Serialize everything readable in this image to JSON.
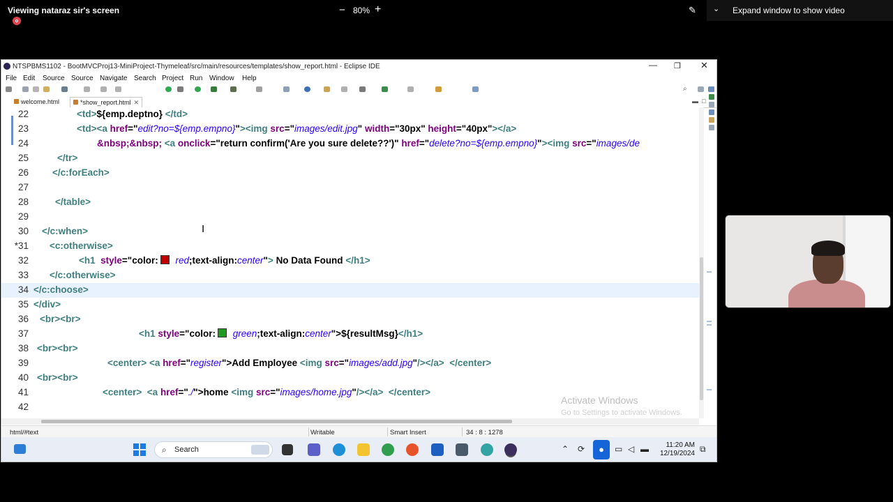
{
  "meeting": {
    "title": "Viewing nataraz sir's screen",
    "zoom_minus": "−",
    "zoom": "80%",
    "zoom_plus": "+",
    "expand_label": "Expand window to show video",
    "chevron": "⌄"
  },
  "eclipse": {
    "window_title": "NTSPBMS1102 - BootMVCProj13-MiniProject-Thymeleaf/src/main/resources/templates/show_report.html - Eclipse IDE",
    "menu": [
      "File",
      "Edit",
      "Source",
      "Source",
      "Navigate",
      "Search",
      "Project",
      "Run",
      "Window",
      "Help"
    ],
    "tabs": [
      {
        "label": "welcome.html"
      },
      {
        "label": "*show_report.html",
        "close": "✕"
      }
    ],
    "status": {
      "path": "html/#text",
      "mode": "Writable",
      "insert": "Smart Insert",
      "position": "34 : 8 : 1278"
    },
    "watermark_title": "Activate Windows",
    "watermark_sub": "Go to Settings to activate Windows."
  },
  "code_lines": [
    {
      "n": "22",
      "parts": [
        [
          "tag",
          "<td>"
        ],
        [
          "text",
          "${emp.deptno} "
        ],
        [
          "tag",
          "</td>"
        ]
      ]
    },
    {
      "n": "23",
      "parts": [
        [
          "tag",
          "<td><a "
        ],
        [
          "attr",
          "href"
        ],
        [
          "sym",
          "="
        ],
        [
          "sym",
          "\""
        ],
        [
          "str",
          "edit?no=${emp.empno}"
        ],
        [
          "sym",
          "\""
        ],
        [
          "tag",
          "><img "
        ],
        [
          "attr",
          "src"
        ],
        [
          "sym",
          "="
        ],
        [
          "sym",
          "\""
        ],
        [
          "str",
          "images/edit.jpg"
        ],
        [
          "sym",
          "\" "
        ],
        [
          "attr",
          "width"
        ],
        [
          "sym",
          "=\"30px\" "
        ],
        [
          "attr",
          "height"
        ],
        [
          "sym",
          "=\"40px\""
        ],
        [
          "tag",
          "></a>"
        ]
      ]
    },
    {
      "n": "24",
      "parts": [
        [
          "attr",
          "&nbsp;&nbsp; "
        ],
        [
          "tag",
          "<a "
        ],
        [
          "attr",
          "onclick"
        ],
        [
          "sym",
          "=\"return confirm('Are you sure delete??')\" "
        ],
        [
          "attr",
          "href"
        ],
        [
          "sym",
          "=\""
        ],
        [
          "str",
          "delete?no=${emp.empno}"
        ],
        [
          "sym",
          "\""
        ],
        [
          "tag",
          "><img "
        ],
        [
          "attr",
          "src"
        ],
        [
          "sym",
          "=\""
        ],
        [
          "str",
          "images/de"
        ]
      ]
    },
    {
      "n": "25",
      "parts": [
        [
          "tag",
          "</tr>"
        ]
      ]
    },
    {
      "n": "26",
      "parts": [
        [
          "tag",
          "</c:forEach>"
        ]
      ]
    },
    {
      "n": "27",
      "parts": []
    },
    {
      "n": "28",
      "parts": [
        [
          "tag",
          "</table>"
        ]
      ]
    },
    {
      "n": "29",
      "parts": []
    },
    {
      "n": "30",
      "parts": [
        [
          "tag",
          "</c:when>"
        ]
      ]
    },
    {
      "n": "31",
      "parts": [
        [
          "tag",
          "<c:otherwise>"
        ]
      ]
    },
    {
      "n": "32",
      "parts": [
        [
          "tag",
          "<h1  "
        ],
        [
          "attr",
          "style"
        ],
        [
          "sym",
          "=\"color:"
        ],
        [
          "swatch",
          "red"
        ],
        [
          "str",
          " red"
        ],
        [
          "sym",
          ";text-align:"
        ],
        [
          "str",
          "center"
        ],
        [
          "sym",
          "\""
        ],
        [
          "tag",
          "> "
        ],
        [
          "text",
          "No Data Found "
        ],
        [
          "tag",
          "</h1>"
        ]
      ]
    },
    {
      "n": "33",
      "parts": [
        [
          "tag",
          "</c:otherwise>"
        ]
      ]
    },
    {
      "n": "34",
      "parts": [
        [
          "tag",
          "</c:choose>"
        ]
      ]
    },
    {
      "n": "35",
      "parts": [
        [
          "tag",
          "</div>"
        ]
      ]
    },
    {
      "n": "36",
      "parts": [
        [
          "tag",
          "<br><br>"
        ]
      ]
    },
    {
      "n": "37",
      "parts": [
        [
          "tag",
          "<h1 "
        ],
        [
          "attr",
          "style"
        ],
        [
          "sym",
          "=\"color:"
        ],
        [
          "swatch",
          "green"
        ],
        [
          "str",
          " green"
        ],
        [
          "sym",
          ";text-align:"
        ],
        [
          "str",
          "center"
        ],
        [
          "sym",
          "\">"
        ],
        [
          "text",
          "${resultMsg}"
        ],
        [
          "tag",
          "</h1>"
        ]
      ]
    },
    {
      "n": "38",
      "parts": [
        [
          "tag",
          "<br><br>"
        ]
      ]
    },
    {
      "n": "39",
      "parts": [
        [
          "tag",
          "<center> <a "
        ],
        [
          "attr",
          "href"
        ],
        [
          "sym",
          "=\""
        ],
        [
          "str",
          "register"
        ],
        [
          "sym",
          "\">"
        ],
        [
          "text",
          "Add Employee "
        ],
        [
          "tag",
          "<img "
        ],
        [
          "attr",
          "src"
        ],
        [
          "sym",
          "=\""
        ],
        [
          "str",
          "images/add.jpg"
        ],
        [
          "sym",
          "\""
        ],
        [
          "tag",
          "/></a>  </center>"
        ]
      ]
    },
    {
      "n": "40",
      "parts": [
        [
          "tag",
          "<br><br>"
        ]
      ]
    },
    {
      "n": "41",
      "parts": [
        [
          "tag",
          "<center>  <a "
        ],
        [
          "attr",
          "href"
        ],
        [
          "sym",
          "=\""
        ],
        [
          "str",
          "./"
        ],
        [
          "sym",
          "\">"
        ],
        [
          "text",
          "home "
        ],
        [
          "tag",
          "<img "
        ],
        [
          "attr",
          "src"
        ],
        [
          "sym",
          "=\""
        ],
        [
          "str",
          "images/home.jpg"
        ],
        [
          "sym",
          "\""
        ],
        [
          "tag",
          "/></a>  </center>"
        ]
      ]
    },
    {
      "n": "42",
      "parts": []
    }
  ],
  "taskbar": {
    "search_label": "Search",
    "search_icon": "⌕",
    "time": "11:20 AM",
    "date": "12/19/2024"
  },
  "colors": {
    "tag": "#3f7f7f",
    "attr": "#7f007f",
    "str": "#2a00ff",
    "red_swatch": "#c00000",
    "green_swatch": "#1f9a1f"
  }
}
